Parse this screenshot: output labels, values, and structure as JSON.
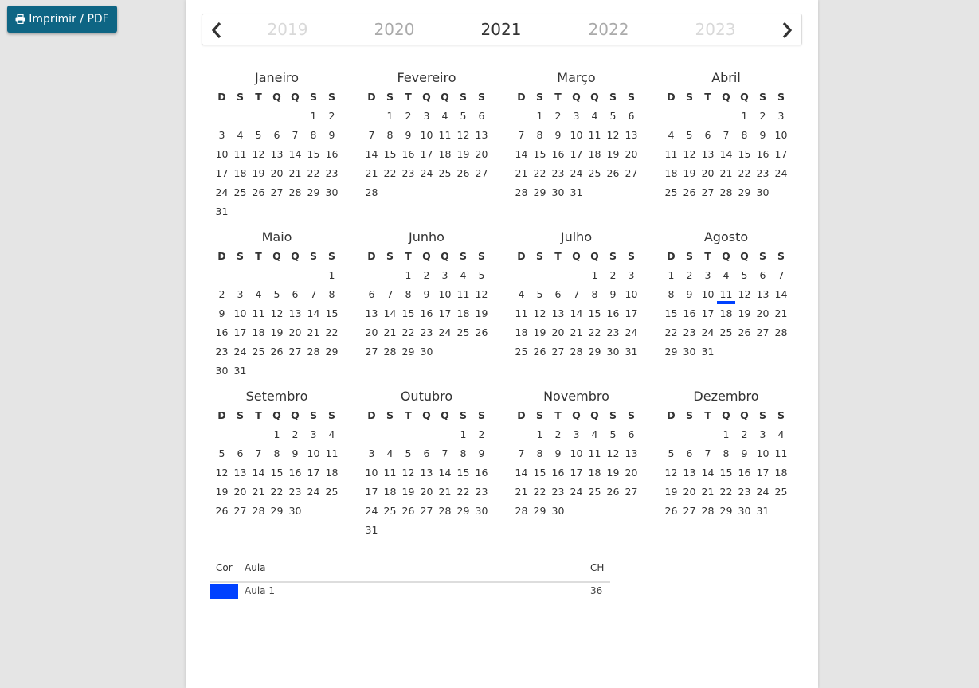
{
  "print_button": {
    "label": "Imprimir / PDF",
    "icon": "print-icon"
  },
  "year_nav": {
    "prev_icon": "chevron-left-icon",
    "next_icon": "chevron-right-icon",
    "years": [
      {
        "label": "2019",
        "state": "far"
      },
      {
        "label": "2020",
        "state": "near"
      },
      {
        "label": "2021",
        "state": "current"
      },
      {
        "label": "2022",
        "state": "near"
      },
      {
        "label": "2023",
        "state": "far"
      }
    ]
  },
  "weekday_labels": [
    "D",
    "S",
    "T",
    "Q",
    "Q",
    "S",
    "S"
  ],
  "months": [
    {
      "name": "Janeiro",
      "offset": 5,
      "days": 31
    },
    {
      "name": "Fevereiro",
      "offset": 1,
      "days": 28
    },
    {
      "name": "Março",
      "offset": 1,
      "days": 31
    },
    {
      "name": "Abril",
      "offset": 4,
      "days": 30
    },
    {
      "name": "Maio",
      "offset": 6,
      "days": 31
    },
    {
      "name": "Junho",
      "offset": 2,
      "days": 30
    },
    {
      "name": "Julho",
      "offset": 4,
      "days": 31
    },
    {
      "name": "Agosto",
      "offset": 0,
      "days": 31,
      "marked_days": [
        11
      ]
    },
    {
      "name": "Setembro",
      "offset": 3,
      "days": 30
    },
    {
      "name": "Outubro",
      "offset": 5,
      "days": 31
    },
    {
      "name": "Novembro",
      "offset": 1,
      "days": 30
    },
    {
      "name": "Dezembro",
      "offset": 3,
      "days": 31
    }
  ],
  "legend": {
    "headers": {
      "color": "Cor",
      "lesson": "Aula",
      "hours": "CH"
    },
    "rows": [
      {
        "color": "#0041ff",
        "lesson": "Aula 1",
        "hours": "36"
      }
    ]
  }
}
